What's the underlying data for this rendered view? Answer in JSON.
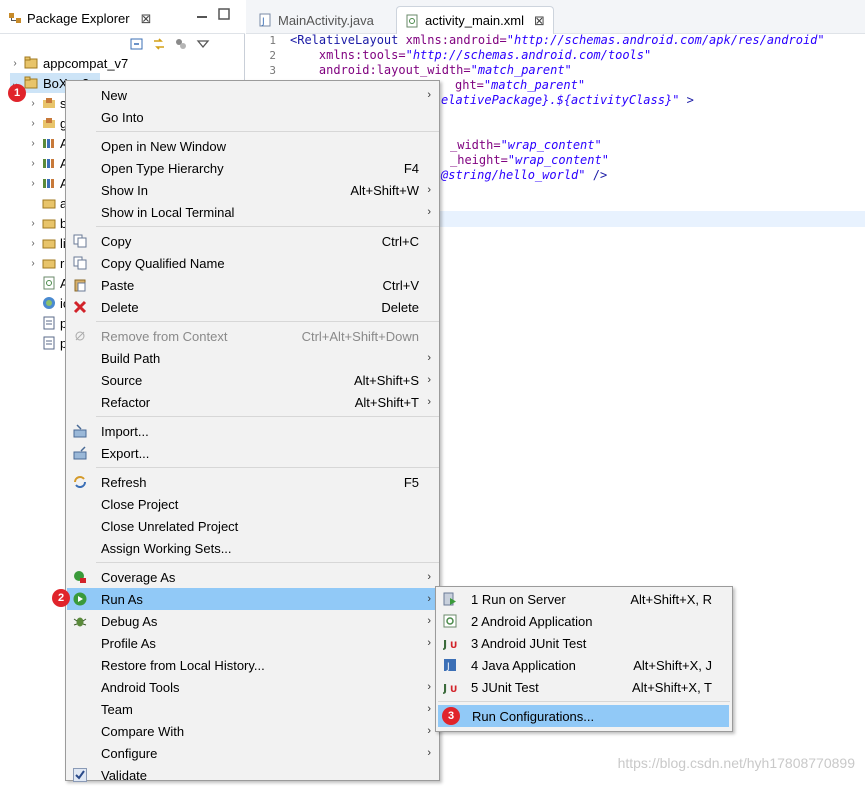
{
  "package_explorer": {
    "tab_label": "Package Explorer",
    "tree": [
      {
        "label": "appcompat_v7",
        "icon": "project-icon"
      },
      {
        "label": "BoXue2",
        "icon": "project-icon",
        "selected": true
      },
      {
        "label": "s",
        "icon": "src-folder-icon"
      },
      {
        "label": "g",
        "icon": "gen-folder-icon"
      },
      {
        "label": "A",
        "icon": "library-icon"
      },
      {
        "label": "A",
        "icon": "library-icon"
      },
      {
        "label": "A",
        "icon": "library-icon"
      },
      {
        "label": "a",
        "icon": "folder-icon"
      },
      {
        "label": "b",
        "icon": "folder-icon"
      },
      {
        "label": "li",
        "icon": "folder-icon"
      },
      {
        "label": "re",
        "icon": "folder-icon"
      },
      {
        "label": "A",
        "icon": "xml-file-icon"
      },
      {
        "label": "ic",
        "icon": "image-file-icon"
      },
      {
        "label": "p",
        "icon": "text-file-icon"
      },
      {
        "label": "p",
        "icon": "text-file-icon"
      }
    ]
  },
  "editor": {
    "tabs": [
      {
        "label": "MainActivity.java",
        "active": false
      },
      {
        "label": "activity_main.xml",
        "active": true
      }
    ],
    "line_numbers": [
      "1",
      "2",
      "3"
    ],
    "lines": {
      "l1a": "<RelativeLayout",
      "l1b": " xmlns:android=",
      "l1c": "\"http://schemas.android.com/apk/res/android\"",
      "l2a": "    xmlns:tools=",
      "l2b": "\"http://schemas.android.com/tools\"",
      "l3a": "    android:layout_width=",
      "l3b": "\"match_parent\"",
      "l4a": "ght=",
      "l4b": "\"match_parent\"",
      "l5a": "elativePackage}.${activityClass}\"",
      "l5b": " >",
      "l6a": "_width=",
      "l6b": "\"wrap_content\"",
      "l7a": "_height=",
      "l7b": "\"wrap_content\"",
      "l8a": "@string/hello_world\"",
      "l8b": " />"
    }
  },
  "context_menu": {
    "items": [
      {
        "label": "New",
        "submenu": true
      },
      {
        "label": "Go Into"
      },
      {
        "label": "Open in New Window"
      },
      {
        "label": "Open Type Hierarchy",
        "shortcut": "F4"
      },
      {
        "label": "Show In",
        "shortcut": "Alt+Shift+W",
        "submenu": true
      },
      {
        "label": "Show in Local Terminal",
        "submenu": true
      },
      {
        "label": "Copy",
        "shortcut": "Ctrl+C",
        "icon": "copy-icon"
      },
      {
        "label": "Copy Qualified Name",
        "icon": "copy-icon"
      },
      {
        "label": "Paste",
        "shortcut": "Ctrl+V",
        "icon": "paste-icon"
      },
      {
        "label": "Delete",
        "shortcut": "Delete",
        "icon": "delete-icon"
      },
      {
        "label": "Remove from Context",
        "shortcut": "Ctrl+Alt+Shift+Down",
        "disabled": true,
        "icon": "remove-context-icon"
      },
      {
        "label": "Build Path",
        "submenu": true
      },
      {
        "label": "Source",
        "shortcut": "Alt+Shift+S",
        "submenu": true
      },
      {
        "label": "Refactor",
        "shortcut": "Alt+Shift+T",
        "submenu": true
      },
      {
        "label": "Import...",
        "icon": "import-icon"
      },
      {
        "label": "Export...",
        "icon": "export-icon"
      },
      {
        "label": "Refresh",
        "shortcut": "F5",
        "icon": "refresh-icon"
      },
      {
        "label": "Close Project"
      },
      {
        "label": "Close Unrelated Project"
      },
      {
        "label": "Assign Working Sets..."
      },
      {
        "label": "Coverage As",
        "submenu": true,
        "icon": "coverage-icon"
      },
      {
        "label": "Run As",
        "submenu": true,
        "icon": "run-icon",
        "highlighted": true
      },
      {
        "label": "Debug As",
        "submenu": true,
        "icon": "debug-icon"
      },
      {
        "label": "Profile As",
        "submenu": true
      },
      {
        "label": "Restore from Local History..."
      },
      {
        "label": "Android Tools",
        "submenu": true
      },
      {
        "label": "Team",
        "submenu": true
      },
      {
        "label": "Compare With",
        "submenu": true
      },
      {
        "label": "Configure",
        "submenu": true
      },
      {
        "label": "Validate",
        "icon": "check-icon"
      }
    ]
  },
  "run_as_submenu": {
    "items": [
      {
        "label": "1 Run on Server",
        "shortcut": "Alt+Shift+X, R"
      },
      {
        "label": "2 Android Application"
      },
      {
        "label": "3 Android JUnit Test"
      },
      {
        "label": "4 Java Application",
        "shortcut": "Alt+Shift+X, J"
      },
      {
        "label": "5 JUnit Test",
        "shortcut": "Alt+Shift+X, T"
      },
      {
        "label": "Run Configurations...",
        "highlighted": true
      }
    ]
  },
  "badges": [
    "1",
    "2",
    "3"
  ],
  "watermark": "https://blog.csdn.net/hyh17808770899",
  "colors": {
    "highlight": "#91c9f7",
    "badge": "#e0242b",
    "menu_bg": "#f2f2f2"
  }
}
